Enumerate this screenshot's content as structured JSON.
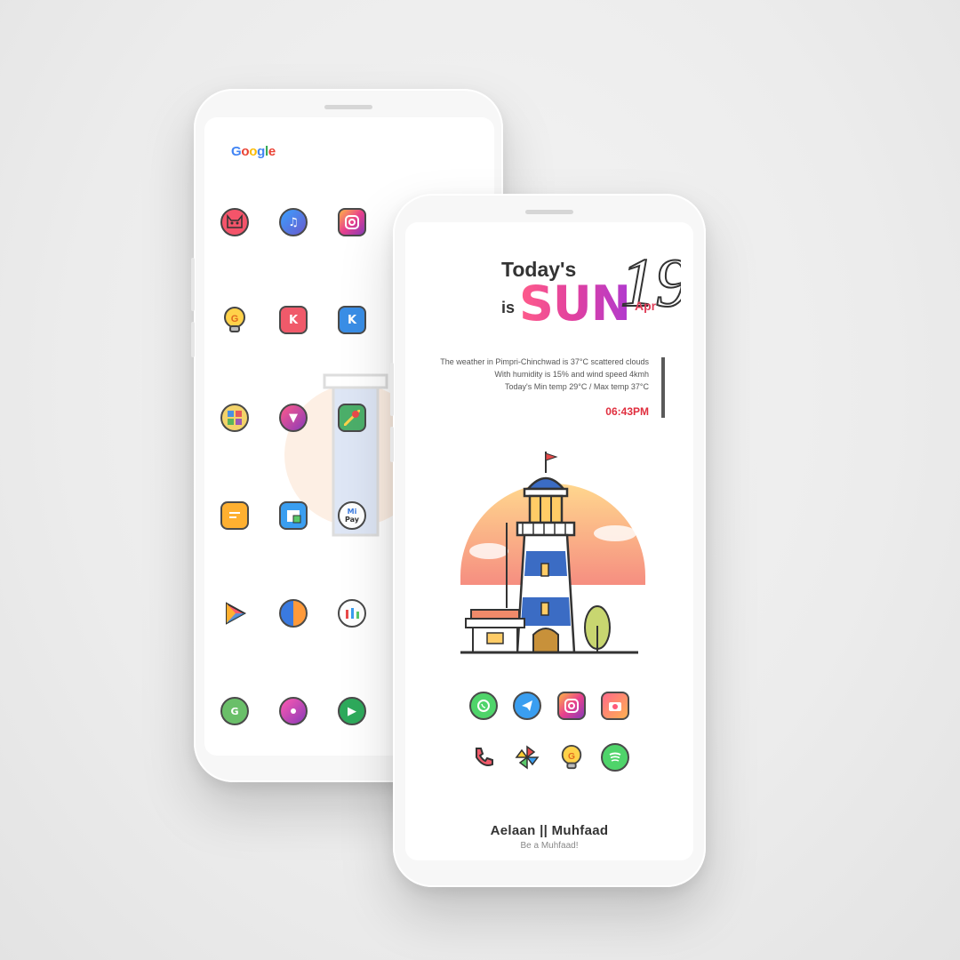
{
  "back_screen": {
    "search_brand": "Google",
    "icons": [
      [
        "cat-icon",
        "music-player-icon",
        "instagram-icon"
      ],
      [
        "bulb-icon",
        "kwgt-icon",
        "kwgt-blue-icon"
      ],
      [
        "app-folder-icon",
        "nova-icon",
        "maps-icon"
      ],
      [
        "messages-icon",
        "calendar-icon",
        "mi-pay-icon"
      ],
      [
        "play-store-icon",
        "contrast-icon",
        "mi-icon"
      ],
      [
        "green-app-icon",
        "music-icon",
        "play-games-icon"
      ]
    ],
    "mi_pay_label_top": "Mi",
    "mi_pay_label_bottom": "Pay"
  },
  "front_screen": {
    "widget": {
      "today_label": "Today's",
      "is_label": "is",
      "day_name": "SUN",
      "day_number": "19",
      "month": "Apr"
    },
    "weather": {
      "line1": "The weather in Pimpri-Chinchwad is 37°C scattered clouds",
      "line2": "With humidity is 15% and wind speed 4kmh",
      "line3": "Today's Min temp 29°C / Max temp 37°C"
    },
    "time": "06:43PM",
    "dock_row1": [
      "whatsapp-icon",
      "telegram-icon",
      "instagram-icon",
      "camera-icon"
    ],
    "dock_row2": [
      "phone-icon",
      "pinwheel-icon",
      "bulb-icon",
      "spotify-icon"
    ],
    "footer_title": "Aelaan || Muhfaad",
    "footer_subtitle": "Be a Muhfaad!"
  },
  "colors": {
    "sun_gradient_start": "#ff5c8a",
    "sun_gradient_end": "#b03ad0",
    "time_red": "#e02e3e"
  }
}
